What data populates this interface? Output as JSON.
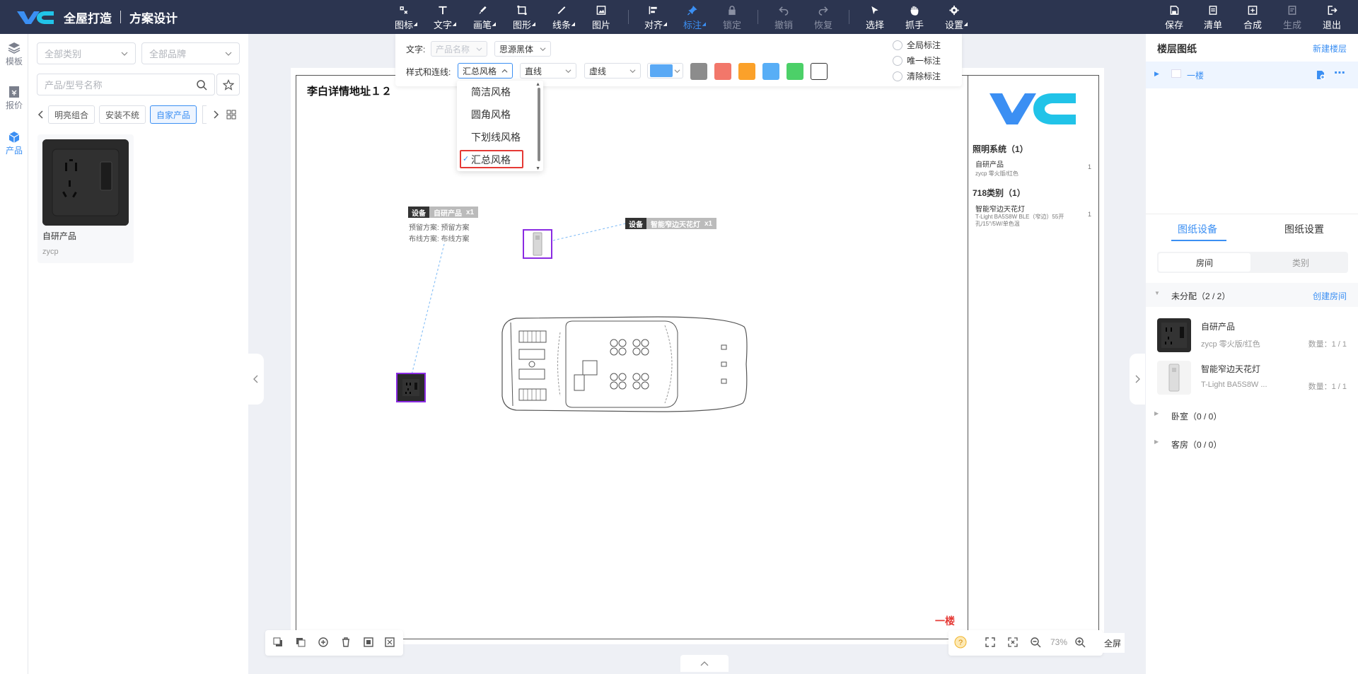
{
  "brand": {
    "title": "全屋打造",
    "subtitle": "方案设计"
  },
  "toolbar": {
    "center": [
      {
        "label": "图标",
        "icon": "icon-icon",
        "state": "normal",
        "dropdown": true
      },
      {
        "label": "文字",
        "icon": "text-icon",
        "state": "normal",
        "dropdown": true
      },
      {
        "label": "画笔",
        "icon": "brush-icon",
        "state": "normal",
        "dropdown": true
      },
      {
        "label": "图形",
        "icon": "shape-icon",
        "state": "normal",
        "dropdown": true
      },
      {
        "label": "线条",
        "icon": "line-icon",
        "state": "normal",
        "dropdown": true
      },
      {
        "label": "图片",
        "icon": "image-icon",
        "state": "normal",
        "dropdown": false
      },
      {
        "label": "对齐",
        "icon": "align-icon",
        "state": "normal",
        "dropdown": true
      },
      {
        "label": "标注",
        "icon": "pin-icon",
        "state": "active",
        "dropdown": true
      },
      {
        "label": "锁定",
        "icon": "lock-icon",
        "state": "disabled",
        "dropdown": false
      },
      {
        "label": "撤销",
        "icon": "undo-icon",
        "state": "disabled",
        "dropdown": false
      },
      {
        "label": "恢复",
        "icon": "redo-icon",
        "state": "disabled",
        "dropdown": false
      },
      {
        "label": "选择",
        "icon": "cursor-icon",
        "state": "normal",
        "dropdown": false
      },
      {
        "label": "抓手",
        "icon": "hand-icon",
        "state": "normal",
        "dropdown": false
      },
      {
        "label": "设置",
        "icon": "gear-icon",
        "state": "normal",
        "dropdown": true
      }
    ],
    "right": [
      {
        "label": "保存",
        "icon": "save-icon",
        "state": "normal"
      },
      {
        "label": "清单",
        "icon": "list-icon",
        "state": "normal"
      },
      {
        "label": "合成",
        "icon": "compose-icon",
        "state": "normal"
      },
      {
        "label": "生成",
        "icon": "generate-icon",
        "state": "disabled"
      },
      {
        "label": "退出",
        "icon": "exit-icon",
        "state": "normal"
      }
    ]
  },
  "rail": [
    {
      "label": "模板",
      "icon": "layers-icon",
      "active": false
    },
    {
      "label": "报价",
      "icon": "quote-icon",
      "active": false
    },
    {
      "label": "产品",
      "icon": "cube-icon",
      "active": true
    }
  ],
  "left_panel": {
    "category_placeholder": "全部类别",
    "brand_placeholder": "全部品牌",
    "search_placeholder": "产品/型号名称",
    "chips": [
      "明亮组合",
      "安装不统",
      "自家产品"
    ],
    "active_chip": "自家产品",
    "product": {
      "name": "自研产品",
      "brand": "zycp"
    }
  },
  "annot_toolbar": {
    "text_label": "文字:",
    "text_field": "产品名称",
    "font": "思源黑体",
    "style_label": "样式和连线:",
    "style_value": "汇总风格",
    "line_type": "直线",
    "dash_type": "虚线",
    "swatches": [
      "#5aa9f5",
      "#8c8c8c",
      "#f2776a",
      "#fba12a",
      "#58aef6",
      "#4cd068",
      "#ffffff"
    ],
    "radios": [
      "全局标注",
      "唯一标注",
      "清除标注"
    ]
  },
  "style_dropdown": {
    "options": [
      "简洁风格",
      "圆角风格",
      "下划线风格",
      "汇总风格"
    ],
    "selected": "汇总风格"
  },
  "sheet": {
    "title": "李白详情地址１２",
    "floor_label": "一楼",
    "tag1": {
      "key": "设备",
      "name": "自研产品",
      "qty": "x1"
    },
    "tag1_note1": "预留方案: 预留方案",
    "tag1_note2": "布线方案: 布线方案",
    "tag2": {
      "key": "设备",
      "name": "智能窄边天花灯",
      "qty": "x1"
    },
    "legend": [
      {
        "title": "照明系统（1）",
        "item": "自研产品",
        "desc": "zycp 零火版/红色",
        "qty": "1"
      },
      {
        "title": "718类别（1）",
        "item": "智能窄边天花灯",
        "desc": "T-Light BA5S8W BLE（窄边）55开孔/15°/5W/单色温",
        "qty": "1"
      }
    ]
  },
  "bottom_bar": {
    "zoom": "73%",
    "fullscreen": "全屏"
  },
  "right_panel": {
    "title": "楼层图纸",
    "new_floor": "新建楼层",
    "floor": "一楼",
    "tabs": [
      "图纸设备",
      "图纸设置"
    ],
    "active_tab": "图纸设备",
    "segments": [
      "房间",
      "类别"
    ],
    "active_segment": "房间",
    "group": {
      "name": "未分配（2 / 2）",
      "action": "创建房间"
    },
    "devices": [
      {
        "name": "自研产品",
        "desc": "zycp 零火版/红色",
        "qty": "数量：1 / 1"
      },
      {
        "name": "智能窄边天花灯",
        "desc": "T-Light BA5S8W ...",
        "qty": "数量：1 / 1"
      }
    ],
    "rooms": [
      "卧室（0 / 0）",
      "客房（0 / 0）"
    ]
  },
  "colors": {
    "topbar": "#2c3550",
    "accent": "#3b8ff3",
    "selection": "#8a2be2",
    "danger": "#e53935"
  }
}
